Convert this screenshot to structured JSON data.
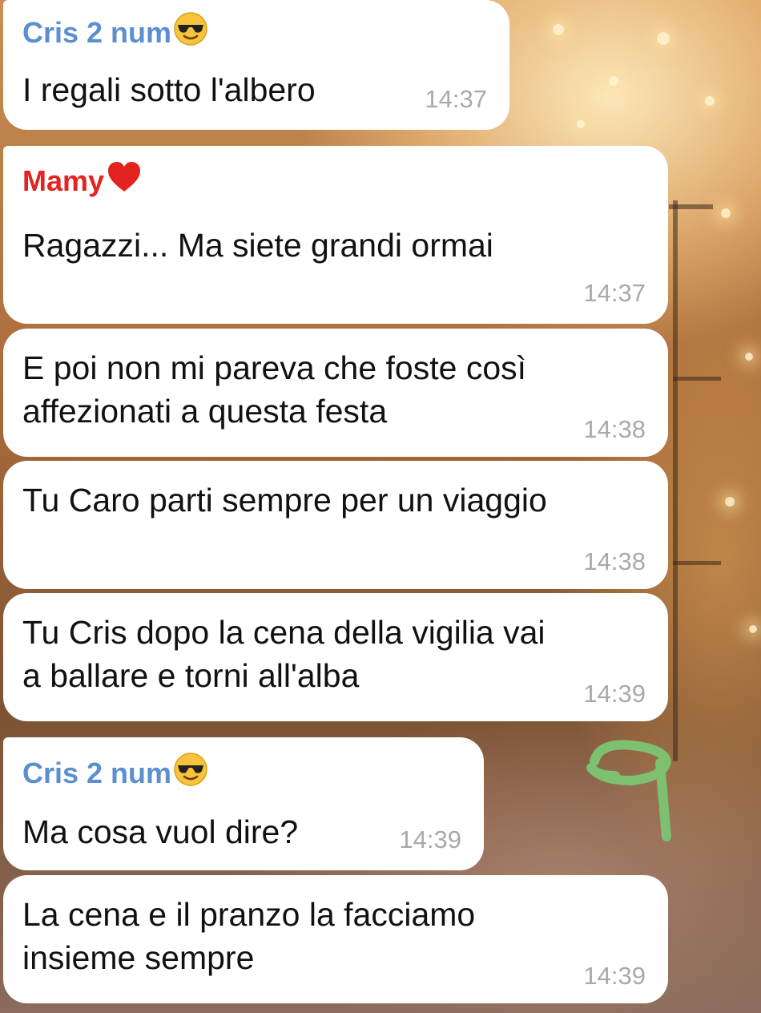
{
  "colors": {
    "cris_name": "#5b8fd1",
    "mamy_name": "#e3231f",
    "bubble_bg": "#ffffff",
    "timestamp": "#a9a9a9",
    "annotation": "#7cc070"
  },
  "messages": [
    {
      "sender": "Cris 2 num",
      "sender_icon": "sunglasses-emoji-icon",
      "text": "I regali sotto l'albero",
      "time": "14:37"
    },
    {
      "sender": "Mamy",
      "sender_icon": "red-heart-emoji-icon",
      "text": "Ragazzi... Ma siete grandi ormai",
      "time": "14:37"
    },
    {
      "text": "E poi non mi pareva che foste così\naffezionati a questa festa",
      "time": "14:38"
    },
    {
      "text": "Tu Caro parti sempre per un viaggio",
      "time": "14:38"
    },
    {
      "text": "Tu Cris dopo la cena della vigilia vai\na ballare e torni all'alba",
      "time": "14:39"
    },
    {
      "sender": "Cris 2 num",
      "sender_icon": "sunglasses-emoji-icon",
      "text": "Ma cosa vuol dire?",
      "time": "14:39"
    },
    {
      "text": "La cena e il pranzo la facciamo\ninsieme sempre",
      "time": "14:39"
    }
  ],
  "annotation_icon": "handwritten-green-mark-icon"
}
